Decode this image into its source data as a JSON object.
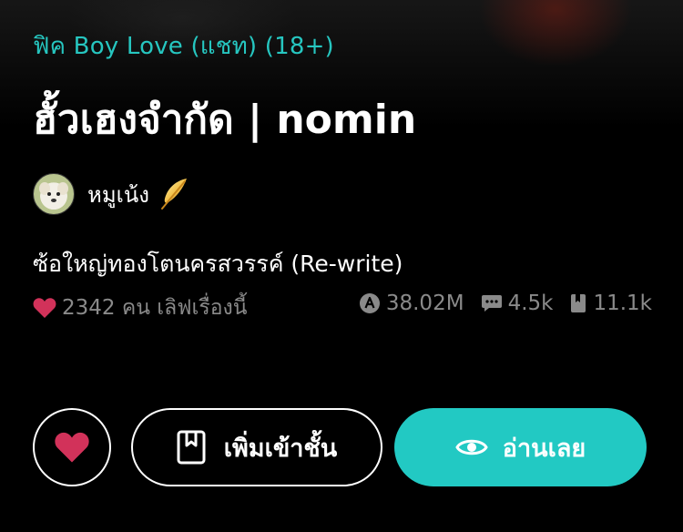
{
  "story": {
    "category": "ฟิค Boy Love (แชท) (18+)",
    "title": "ฮั้วเฮงจำกัด | nomin",
    "synopsis": "ซ้อใหญ่ทองโตนครสวรรค์ (Re-write)"
  },
  "author": {
    "name": "หมูเน้ง",
    "avatar_icon": "puppy-avatar",
    "badge_icon": "golden-feather-icon"
  },
  "stats": {
    "likes_text": "2342 คน เลิฟเรื่องนี้",
    "views": "38.02M",
    "comments": "4.5k",
    "chapters": "11.1k"
  },
  "actions": {
    "like_icon": "heart-icon",
    "add_to_shelf_label": "เพิ่มเข้าชั้น",
    "read_now_label": "อ่านเลย"
  },
  "colors": {
    "accent": "#22c9c3",
    "category": "#26c6c0",
    "heart": "#d2325a",
    "muted": "#8a8a8a",
    "background": "#000000"
  }
}
